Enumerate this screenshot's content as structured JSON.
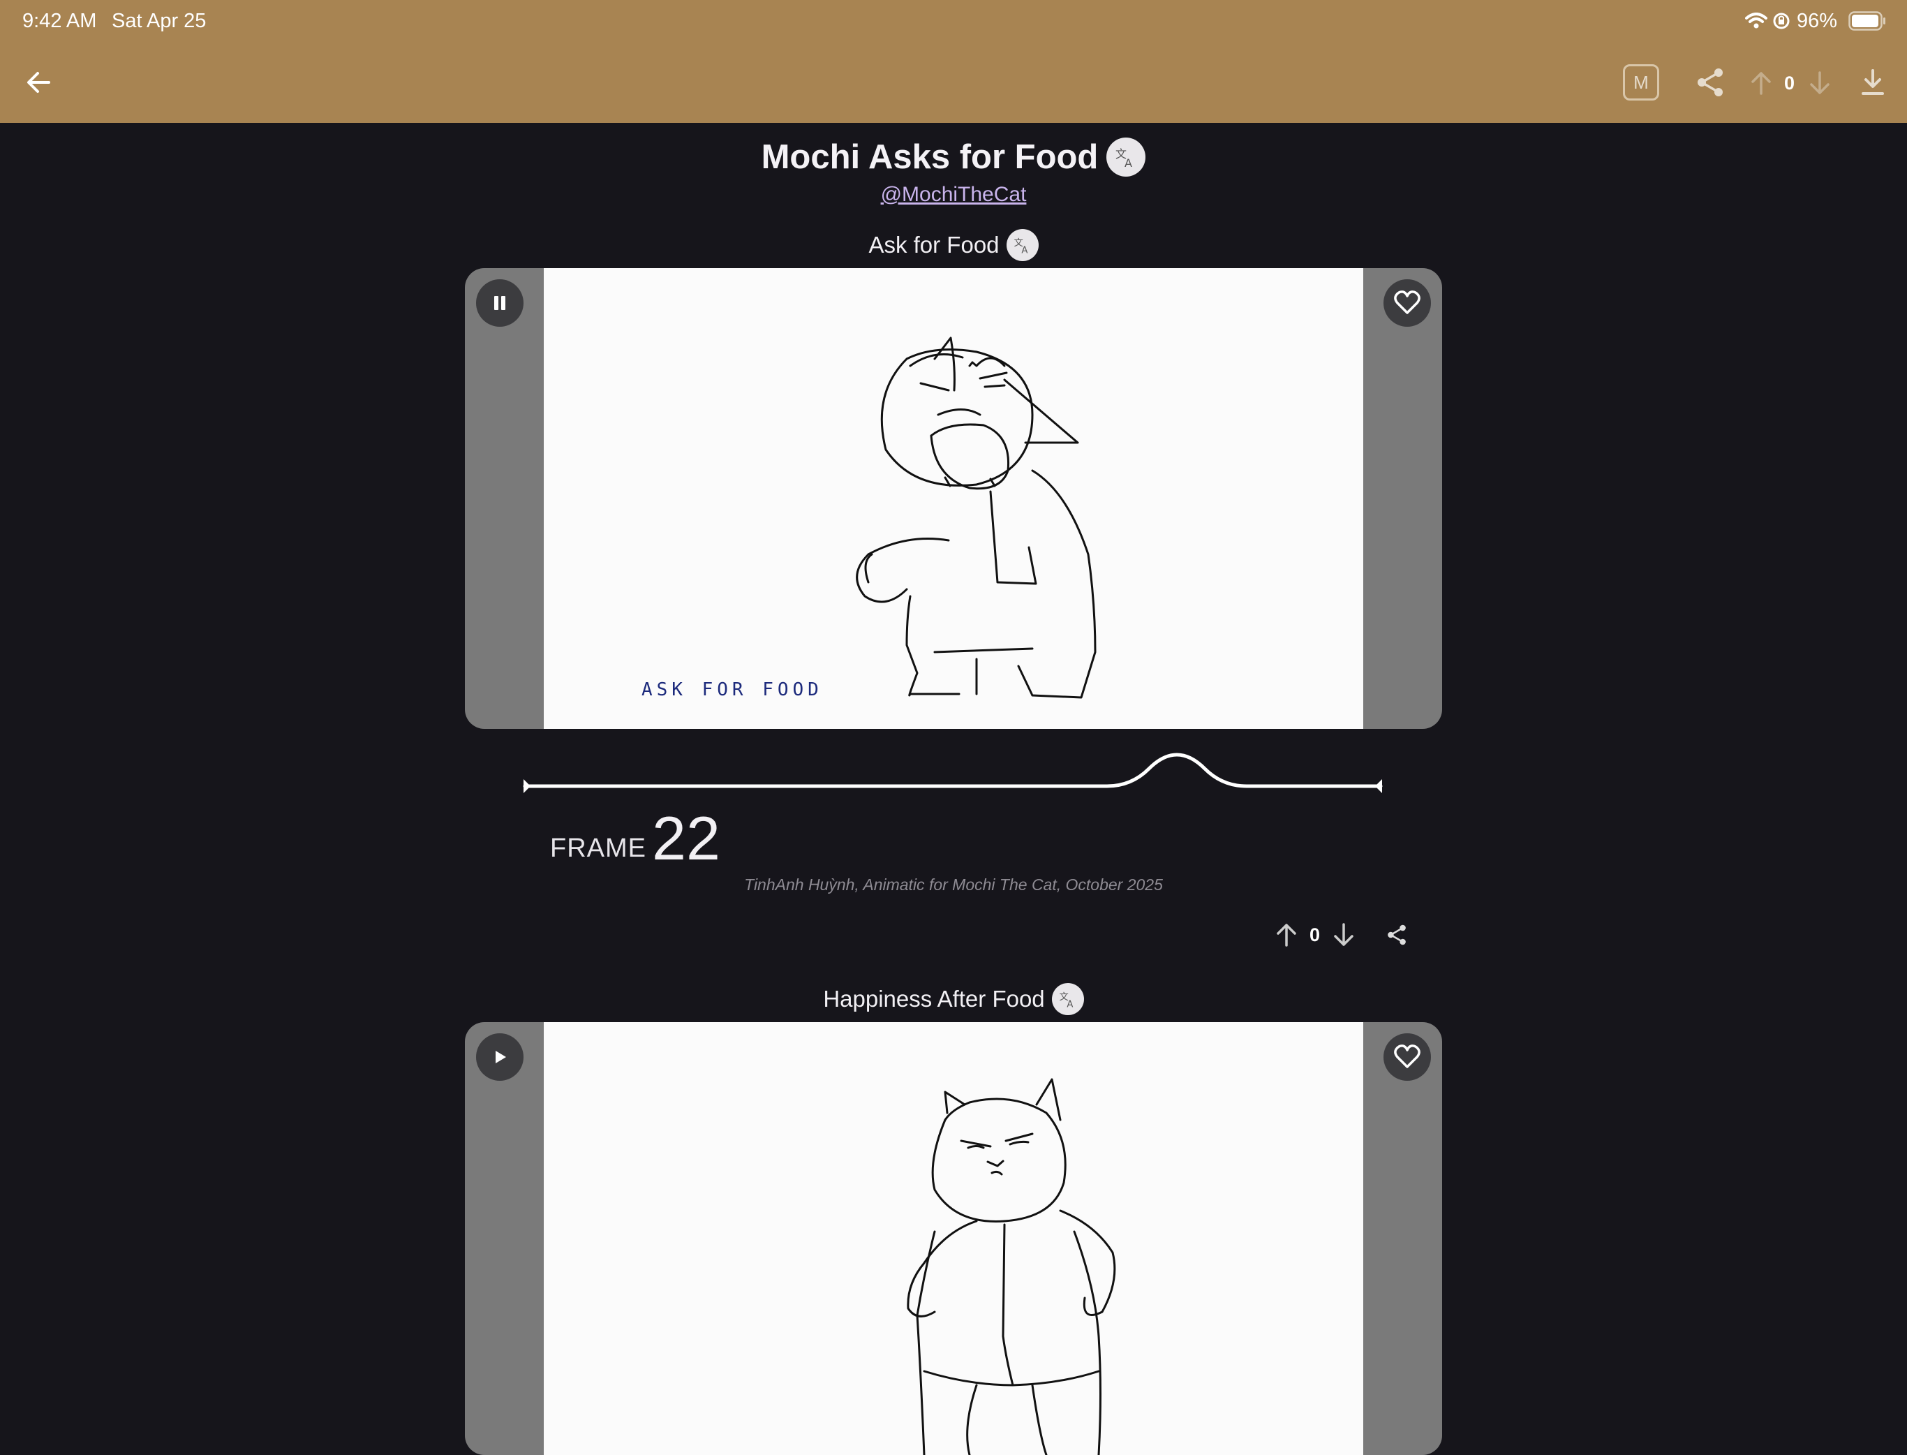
{
  "status_bar": {
    "time": "9:42 AM",
    "date": "Sat Apr 25",
    "battery": "96%"
  },
  "toolbar": {
    "back_icon": "arrow-left-icon",
    "m_button_label": "M",
    "vote_count": "0",
    "colors": {
      "header_bg": "#a88452",
      "page_bg": "#16151b"
    }
  },
  "post": {
    "title": "Mochi Asks for Food",
    "author": "@MochiTheCat"
  },
  "animations": [
    {
      "title": "Ask for Food",
      "playback_state": "playing",
      "drawing_text": "ASK FOR FOOD",
      "frame_label": "FRAME",
      "frame_number": "22",
      "caption": "TinhAnh Huỳnh, Animatic for Mochi The Cat, October 2025",
      "vote_count": "0"
    },
    {
      "title": "Happiness After Food",
      "playback_state": "paused"
    }
  ]
}
